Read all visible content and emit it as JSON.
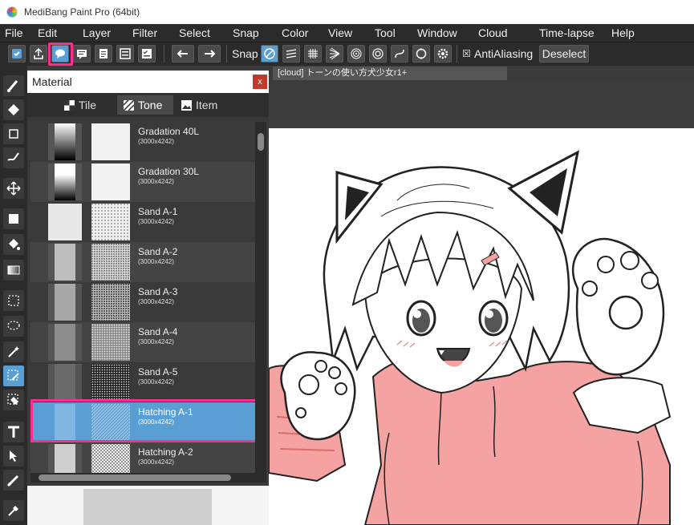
{
  "window": {
    "title": "MediBang Paint Pro (64bit)"
  },
  "menu": [
    "File",
    "Edit",
    "Layer",
    "Filter",
    "Select",
    "Snap",
    "Color",
    "View",
    "Tool",
    "Window",
    "Cloud",
    "Time-lapse",
    "Help"
  ],
  "toolbar": {
    "snap_label": "Snap",
    "antialias_label": "AntiAliasing",
    "antialias_checked": "☒",
    "deselect_label": "Deselect"
  },
  "document": {
    "tab_title": "[cloud] トーンの使い方犬少女r1+"
  },
  "material_panel": {
    "title": "Material",
    "close_label": "x",
    "tabs": [
      {
        "label": "Tile",
        "active": false
      },
      {
        "label": "Tone",
        "active": true
      },
      {
        "label": "Item",
        "active": false
      }
    ],
    "items": [
      {
        "name": "Gradation 40L",
        "size": "(3000x4242)"
      },
      {
        "name": "Gradation 30L",
        "size": "(3000x4242)"
      },
      {
        "name": "Sand A-1",
        "size": "(3000x4242)"
      },
      {
        "name": "Sand A-2",
        "size": "(3000x4242)"
      },
      {
        "name": "Sand A-3",
        "size": "(3000x4242)"
      },
      {
        "name": "Sand A-4",
        "size": "(3000x4242)"
      },
      {
        "name": "Sand A-5",
        "size": "(3000x4242)"
      },
      {
        "name": "Hatching A-1",
        "size": "(3000x4242)"
      },
      {
        "name": "Hatching A-2",
        "size": "(3000x4242)"
      }
    ],
    "selected_index": 7
  },
  "colors": {
    "highlight": "#ff2d8d",
    "selection": "#5a9fd4",
    "hoodie": "#f4a2a2"
  }
}
